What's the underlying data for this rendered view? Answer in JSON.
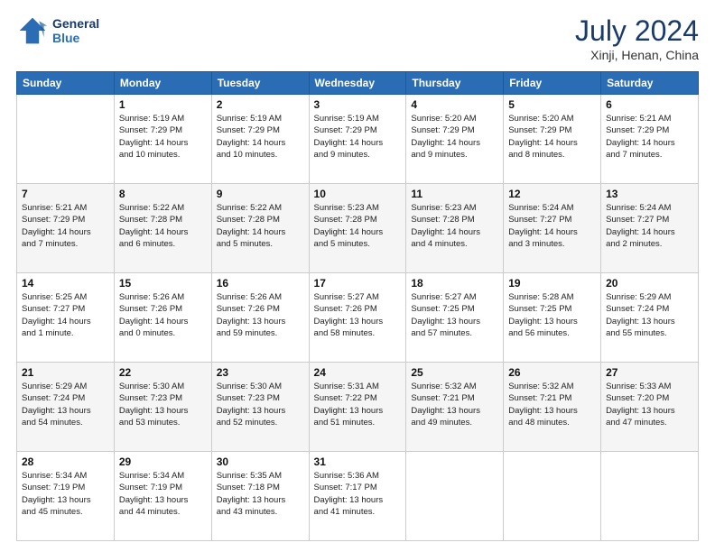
{
  "header": {
    "logo_line1": "General",
    "logo_line2": "Blue",
    "main_title": "July 2024",
    "subtitle": "Xinji, Henan, China"
  },
  "calendar": {
    "days_of_week": [
      "Sunday",
      "Monday",
      "Tuesday",
      "Wednesday",
      "Thursday",
      "Friday",
      "Saturday"
    ],
    "weeks": [
      [
        {
          "day": "",
          "info": ""
        },
        {
          "day": "1",
          "info": "Sunrise: 5:19 AM\nSunset: 7:29 PM\nDaylight: 14 hours\nand 10 minutes."
        },
        {
          "day": "2",
          "info": "Sunrise: 5:19 AM\nSunset: 7:29 PM\nDaylight: 14 hours\nand 10 minutes."
        },
        {
          "day": "3",
          "info": "Sunrise: 5:19 AM\nSunset: 7:29 PM\nDaylight: 14 hours\nand 9 minutes."
        },
        {
          "day": "4",
          "info": "Sunrise: 5:20 AM\nSunset: 7:29 PM\nDaylight: 14 hours\nand 9 minutes."
        },
        {
          "day": "5",
          "info": "Sunrise: 5:20 AM\nSunset: 7:29 PM\nDaylight: 14 hours\nand 8 minutes."
        },
        {
          "day": "6",
          "info": "Sunrise: 5:21 AM\nSunset: 7:29 PM\nDaylight: 14 hours\nand 7 minutes."
        }
      ],
      [
        {
          "day": "7",
          "info": "Sunrise: 5:21 AM\nSunset: 7:29 PM\nDaylight: 14 hours\nand 7 minutes."
        },
        {
          "day": "8",
          "info": "Sunrise: 5:22 AM\nSunset: 7:28 PM\nDaylight: 14 hours\nand 6 minutes."
        },
        {
          "day": "9",
          "info": "Sunrise: 5:22 AM\nSunset: 7:28 PM\nDaylight: 14 hours\nand 5 minutes."
        },
        {
          "day": "10",
          "info": "Sunrise: 5:23 AM\nSunset: 7:28 PM\nDaylight: 14 hours\nand 5 minutes."
        },
        {
          "day": "11",
          "info": "Sunrise: 5:23 AM\nSunset: 7:28 PM\nDaylight: 14 hours\nand 4 minutes."
        },
        {
          "day": "12",
          "info": "Sunrise: 5:24 AM\nSunset: 7:27 PM\nDaylight: 14 hours\nand 3 minutes."
        },
        {
          "day": "13",
          "info": "Sunrise: 5:24 AM\nSunset: 7:27 PM\nDaylight: 14 hours\nand 2 minutes."
        }
      ],
      [
        {
          "day": "14",
          "info": "Sunrise: 5:25 AM\nSunset: 7:27 PM\nDaylight: 14 hours\nand 1 minute."
        },
        {
          "day": "15",
          "info": "Sunrise: 5:26 AM\nSunset: 7:26 PM\nDaylight: 14 hours\nand 0 minutes."
        },
        {
          "day": "16",
          "info": "Sunrise: 5:26 AM\nSunset: 7:26 PM\nDaylight: 13 hours\nand 59 minutes."
        },
        {
          "day": "17",
          "info": "Sunrise: 5:27 AM\nSunset: 7:26 PM\nDaylight: 13 hours\nand 58 minutes."
        },
        {
          "day": "18",
          "info": "Sunrise: 5:27 AM\nSunset: 7:25 PM\nDaylight: 13 hours\nand 57 minutes."
        },
        {
          "day": "19",
          "info": "Sunrise: 5:28 AM\nSunset: 7:25 PM\nDaylight: 13 hours\nand 56 minutes."
        },
        {
          "day": "20",
          "info": "Sunrise: 5:29 AM\nSunset: 7:24 PM\nDaylight: 13 hours\nand 55 minutes."
        }
      ],
      [
        {
          "day": "21",
          "info": "Sunrise: 5:29 AM\nSunset: 7:24 PM\nDaylight: 13 hours\nand 54 minutes."
        },
        {
          "day": "22",
          "info": "Sunrise: 5:30 AM\nSunset: 7:23 PM\nDaylight: 13 hours\nand 53 minutes."
        },
        {
          "day": "23",
          "info": "Sunrise: 5:30 AM\nSunset: 7:23 PM\nDaylight: 13 hours\nand 52 minutes."
        },
        {
          "day": "24",
          "info": "Sunrise: 5:31 AM\nSunset: 7:22 PM\nDaylight: 13 hours\nand 51 minutes."
        },
        {
          "day": "25",
          "info": "Sunrise: 5:32 AM\nSunset: 7:21 PM\nDaylight: 13 hours\nand 49 minutes."
        },
        {
          "day": "26",
          "info": "Sunrise: 5:32 AM\nSunset: 7:21 PM\nDaylight: 13 hours\nand 48 minutes."
        },
        {
          "day": "27",
          "info": "Sunrise: 5:33 AM\nSunset: 7:20 PM\nDaylight: 13 hours\nand 47 minutes."
        }
      ],
      [
        {
          "day": "28",
          "info": "Sunrise: 5:34 AM\nSunset: 7:19 PM\nDaylight: 13 hours\nand 45 minutes."
        },
        {
          "day": "29",
          "info": "Sunrise: 5:34 AM\nSunset: 7:19 PM\nDaylight: 13 hours\nand 44 minutes."
        },
        {
          "day": "30",
          "info": "Sunrise: 5:35 AM\nSunset: 7:18 PM\nDaylight: 13 hours\nand 43 minutes."
        },
        {
          "day": "31",
          "info": "Sunrise: 5:36 AM\nSunset: 7:17 PM\nDaylight: 13 hours\nand 41 minutes."
        },
        {
          "day": "",
          "info": ""
        },
        {
          "day": "",
          "info": ""
        },
        {
          "day": "",
          "info": ""
        }
      ]
    ]
  }
}
